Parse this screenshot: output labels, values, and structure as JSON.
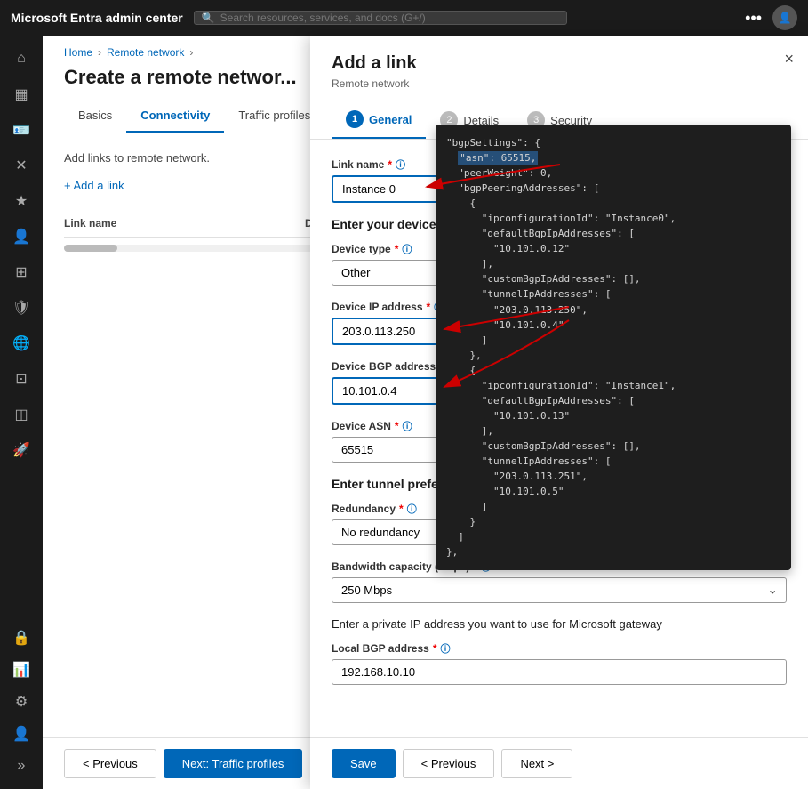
{
  "topbar": {
    "brand": "Microsoft Entra admin center",
    "search_placeholder": "Search resources, services, and docs (G+/)"
  },
  "breadcrumb": {
    "home": "Home",
    "section": "Remote network"
  },
  "page": {
    "title": "Create a remote networ...",
    "add_links_text": "Add links to remote network.",
    "add_link_btn": "+ Add a link"
  },
  "tabs": [
    {
      "label": "Basics",
      "active": false
    },
    {
      "label": "Connectivity",
      "active": true
    },
    {
      "label": "Traffic profiles",
      "active": false
    }
  ],
  "table": {
    "columns": [
      "Link name",
      "Device type",
      "D"
    ]
  },
  "bottom_nav": {
    "prev": "< Previous",
    "next": "Next: Traffic profiles"
  },
  "panel": {
    "title": "Add a link",
    "subtitle": "Remote network",
    "close_label": "×",
    "tabs": [
      {
        "num": "1",
        "label": "General",
        "active": true
      },
      {
        "num": "2",
        "label": "Details",
        "active": false
      },
      {
        "num": "3",
        "label": "Security",
        "active": false
      }
    ],
    "fields": {
      "link_name_label": "Link name",
      "link_name_value": "Instance 0",
      "device_info_section": "Enter your device info",
      "device_type_label": "Device type",
      "device_type_value": "Other",
      "device_ip_label": "Device IP address",
      "device_ip_value": "203.0.113.250",
      "device_bgp_label": "Device BGP address",
      "device_bgp_value": "10.101.0.4",
      "device_asn_label": "Device ASN",
      "device_asn_value": "65515",
      "tunnel_section": "Enter tunnel preference",
      "redundancy_label": "Redundancy",
      "redundancy_value": "No redundancy",
      "bandwidth_label": "Bandwidth capacity (Mbps)",
      "bandwidth_value": "250 Mbps",
      "local_bgp_section": "Enter a private IP address you want to use for Microsoft gateway",
      "local_bgp_label": "Local BGP address",
      "local_bgp_value": "192.168.10.10"
    },
    "bottom": {
      "save": "Save",
      "prev": "< Previous",
      "next": "Next >"
    }
  },
  "code": {
    "content": "\"bgpSettings\": {\n  \"asn\": 65515,\n  \"peerWeight\": 0,\n  \"bgpPeeringAddresses\": [\n    {\n      \"ipconfigurationId\": \"Instance0\",\n      \"defaultBgpIpAddresses\": [\n        \"10.101.0.12\"\n      ],\n      \"customBgpIpAddresses\": [],\n      \"tunnelIpAddresses\": [\n        \"203.0.113.250\",\n        \"10.101.0.4\"\n      ]\n    },\n    {\n      \"ipconfigurationId\": \"Instance1\",\n      \"defaultBgpIpAddresses\": [\n        \"10.101.0.13\"\n      ],\n      \"customBgpIpAddresses\": [],\n      \"tunnelIpAddresses\": [\n        \"203.0.113.251\",\n        \"10.101.0.5\"\n      ]\n    }\n  ]\n},"
  },
  "sidebar": {
    "icons": [
      {
        "name": "home-icon",
        "symbol": "⌂"
      },
      {
        "name": "dashboard-icon",
        "symbol": "▦"
      },
      {
        "name": "id-icon",
        "symbol": "🪪"
      },
      {
        "name": "cross-icon",
        "symbol": "✕"
      },
      {
        "name": "star-icon",
        "symbol": "★"
      },
      {
        "name": "users-icon",
        "symbol": "👤"
      },
      {
        "name": "groups-icon",
        "symbol": "⊞"
      },
      {
        "name": "shield-icon",
        "symbol": "🛡"
      },
      {
        "name": "globe-icon",
        "symbol": "🌐"
      },
      {
        "name": "grid-icon",
        "symbol": "⋮⋮"
      },
      {
        "name": "app-icon",
        "symbol": "◫"
      },
      {
        "name": "rocket-icon",
        "symbol": "🚀"
      },
      {
        "name": "lock-icon",
        "symbol": "🔒"
      },
      {
        "name": "chart-icon",
        "symbol": "📊"
      },
      {
        "name": "settings-icon",
        "symbol": "⚙"
      },
      {
        "name": "person-icon",
        "symbol": "👤"
      },
      {
        "name": "expand-icon",
        "symbol": "»"
      }
    ]
  }
}
